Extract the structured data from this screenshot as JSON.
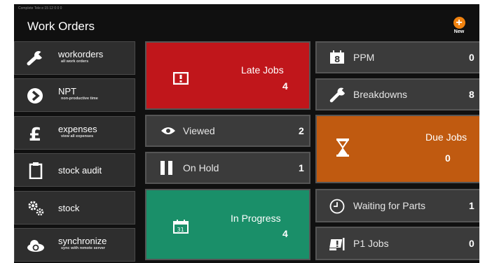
{
  "app": {
    "status_text": "Complete Tele e 15 12 0 0 0",
    "title": "Work Orders",
    "new_label": "New",
    "new_glyph": "+"
  },
  "sidebar": {
    "items": [
      {
        "label": "workorders",
        "sub": "all work orders",
        "icon": "wrench-icon"
      },
      {
        "label": "NPT",
        "sub": "non-productive time",
        "icon": "chevron-right-icon"
      },
      {
        "label": "expenses",
        "sub": "view all expenses",
        "icon": "pound-icon"
      },
      {
        "label": "stock audit",
        "icon": "clipboard-icon"
      },
      {
        "label": "stock",
        "icon": "gears-icon"
      },
      {
        "label": "synchronize",
        "sub": "sync with remote server",
        "icon": "cloud-sync-icon"
      }
    ]
  },
  "tiles": {
    "late_jobs": {
      "label": "Late Jobs",
      "count": "4",
      "color": "#c0161b"
    },
    "viewed": {
      "label": "Viewed",
      "count": "2"
    },
    "on_hold": {
      "label": "On Hold",
      "count": "1"
    },
    "in_progress": {
      "label": "In Progress",
      "count": "4",
      "color": "#1a8f69"
    },
    "ppm": {
      "label": "PPM",
      "count": "0",
      "icon_text": "8"
    },
    "breakdowns": {
      "label": "Breakdowns",
      "count": "8"
    },
    "due_jobs": {
      "label": "Due Jobs",
      "count": "0",
      "color": "#c05a10"
    },
    "waiting_for_parts": {
      "label": "Waiting for Parts",
      "count": "1"
    },
    "p1_jobs": {
      "label": "P1 Jobs",
      "count": "0"
    }
  },
  "calendar_icon_text": "31",
  "colors": {
    "accent_orange": "#f0820f",
    "tile_gray": "#3b3b3b",
    "background": "#101010"
  }
}
